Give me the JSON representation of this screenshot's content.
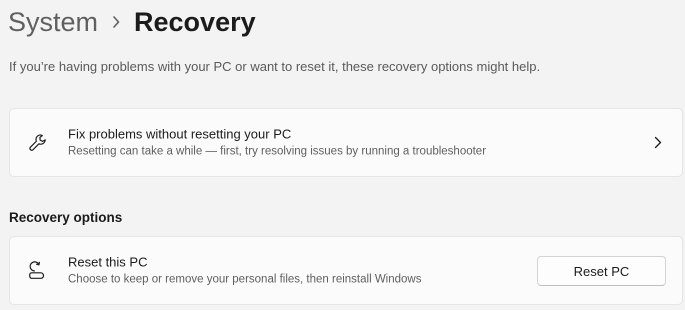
{
  "breadcrumb": {
    "parent": "System",
    "current": "Recovery"
  },
  "intro_text": "If you’re having problems with your PC or want to reset it, these recovery options might help.",
  "fix_card": {
    "icon": "wrench-icon",
    "title": "Fix problems without resetting your PC",
    "subtitle": "Resetting can take a while — first, try resolving issues by running a troubleshooter",
    "chevron": "chevron-right-icon"
  },
  "recovery_options": {
    "heading": "Recovery options",
    "reset": {
      "icon": "reset-pc-icon",
      "title": "Reset this PC",
      "subtitle": "Choose to keep or remove your personal files, then reinstall Windows",
      "button_label": "Reset PC"
    }
  }
}
